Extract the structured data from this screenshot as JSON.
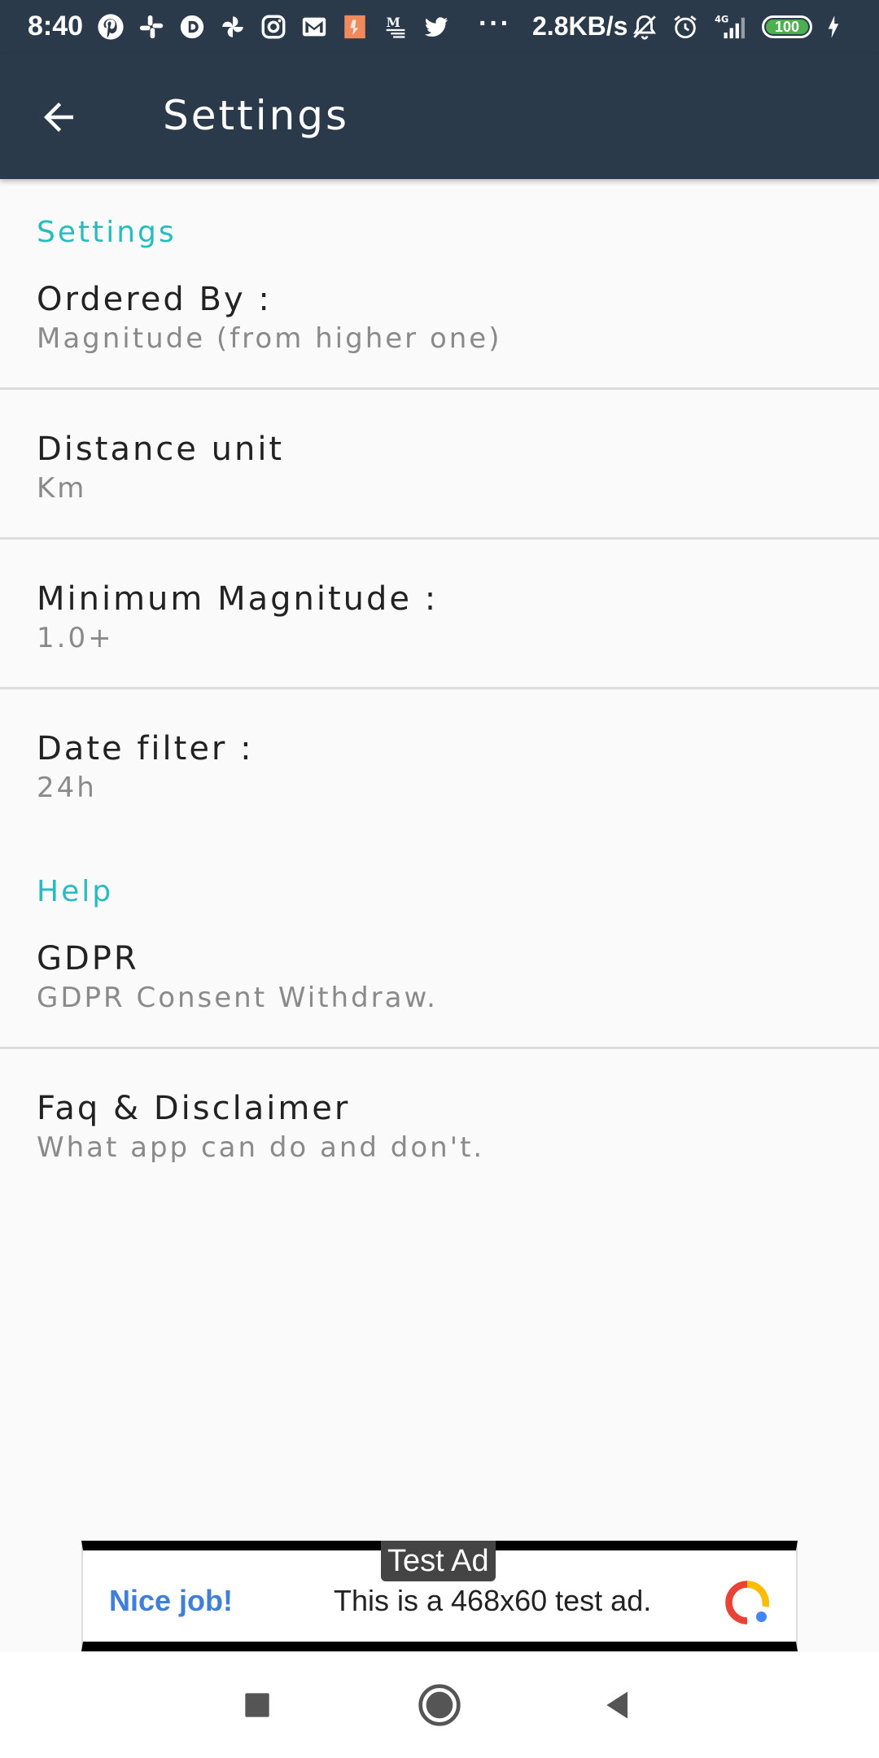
{
  "status_bar": {
    "time": "8:40",
    "more": "···",
    "net_speed": "2.8KB/s",
    "network": "4G",
    "battery": "100",
    "notification_icons": [
      "pinterest-icon",
      "slack-icon",
      "dailyhunt-icon",
      "pinwheel-icon",
      "instagram-icon",
      "gmail-icon",
      "app-icon",
      "medium-icon",
      "twitter-icon"
    ],
    "system_icons": [
      "mute-icon",
      "alarm-icon",
      "signal-icon",
      "battery-icon",
      "charging-icon"
    ]
  },
  "app_bar": {
    "title": "Settings",
    "back_icon": "arrow-back-icon",
    "background": "#2b3a4a"
  },
  "sections": [
    {
      "header": "Settings",
      "items": [
        {
          "title": "Ordered By :",
          "summary": "Magnitude (from higher one)"
        },
        {
          "title": "Distance unit",
          "summary": "Km"
        },
        {
          "title": "Minimum Magnitude :",
          "summary": "1.0+"
        },
        {
          "title": "Date filter :",
          "summary": "24h"
        }
      ]
    },
    {
      "header": "Help",
      "items": [
        {
          "title": "GDPR",
          "summary": "GDPR Consent Withdraw."
        },
        {
          "title": "Faq & Disclaimer",
          "summary": "What app can do and don't."
        }
      ]
    }
  ],
  "ad": {
    "badge": "Test Ad",
    "headline": "Nice job!",
    "text": "This is a 468x60 test ad."
  },
  "nav_bar": {
    "buttons": [
      "recents-icon",
      "home-icon",
      "back-icon"
    ]
  },
  "colors": {
    "accent": "#26bcc0",
    "toolbar": "#2b3a4a",
    "background": "#fafafa",
    "ad_headline": "#3f7fd8"
  }
}
